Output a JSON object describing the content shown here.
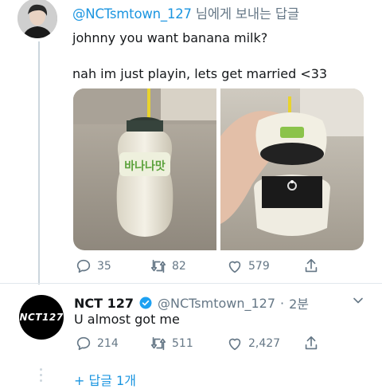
{
  "top_tweet": {
    "replying_handle": "@NCTsmtown_127",
    "replying_suffix": "님에게 보내는 답글",
    "line1": "johnny you want banana milk?",
    "line2": "nah im just playin, lets get married <33",
    "media_label": "바나나맛",
    "actions": {
      "replies": "35",
      "retweets": "82",
      "likes": "579"
    }
  },
  "reply_tweet": {
    "name": "NCT 127",
    "handle": "@NCTsmtown_127",
    "dot": "·",
    "time": "2분",
    "avatar_logo": "NCT127",
    "text": "U almost got me",
    "actions": {
      "replies": "214",
      "retweets": "511",
      "likes": "2,427"
    }
  },
  "more_replies": "+ 답글 1개",
  "colors": {
    "link": "#1b95e0",
    "muted": "#657786",
    "verified": "#1da1f2"
  }
}
